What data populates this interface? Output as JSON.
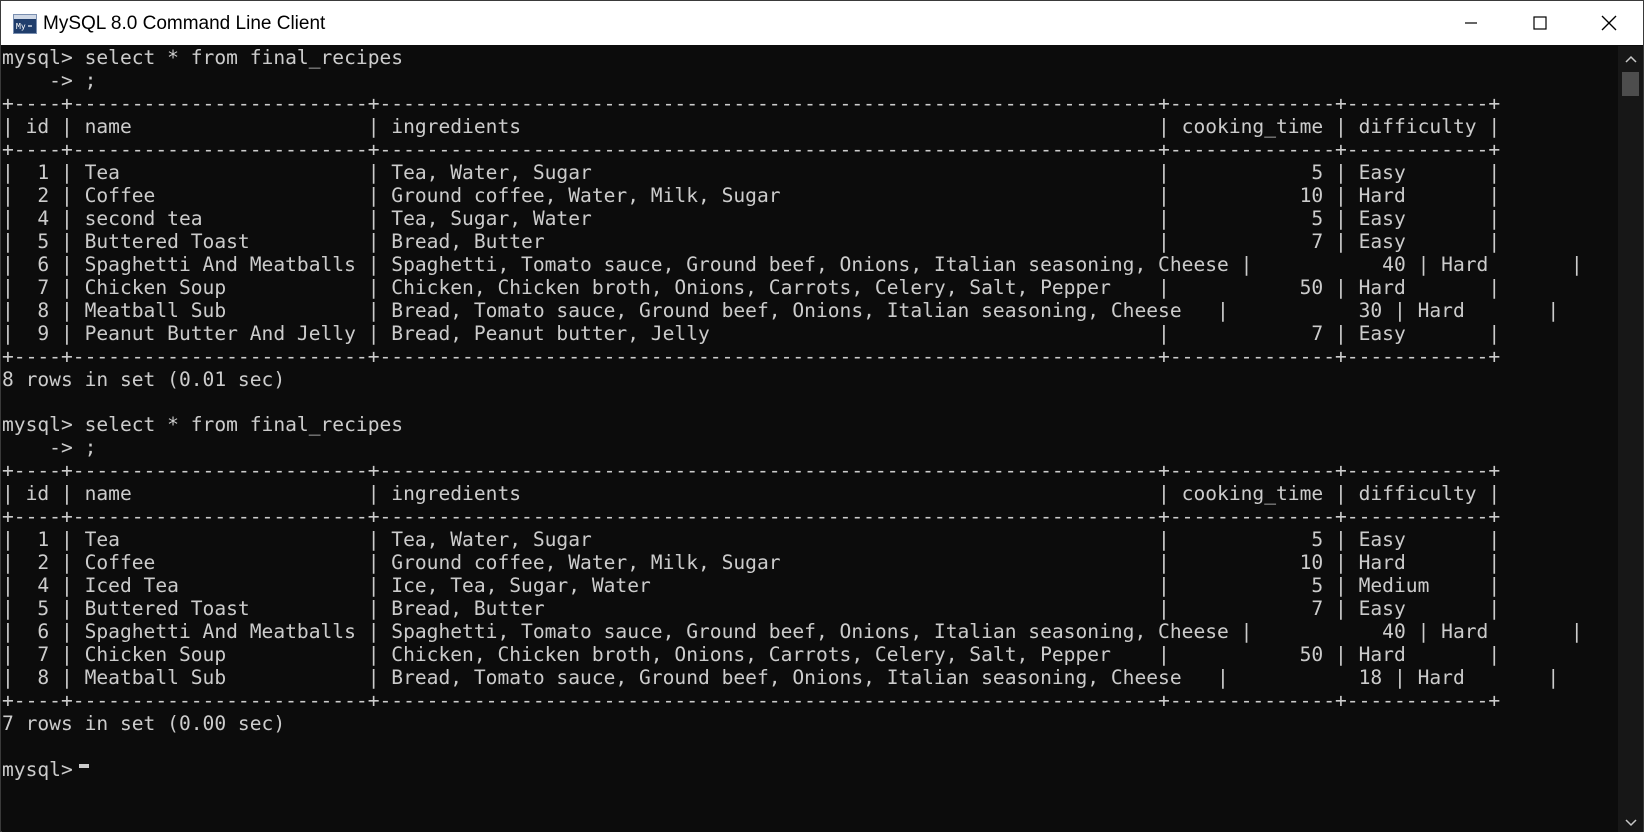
{
  "window": {
    "title": "MySQL 8.0 Command Line Client",
    "icons": {
      "app": "mysql-console-icon",
      "minimize": "minimize-icon",
      "maximize": "maximize-icon",
      "close": "close-icon"
    }
  },
  "colors": {
    "console_background": "#0c0c0c",
    "console_text": "#cccccc",
    "titlebar_background": "#ffffff"
  },
  "terminal": {
    "lines": [
      "mysql> select * from final_recipes",
      "    -> ;",
      "+----+-------------------------+------------------------------------------------------------------+--------------+------------+",
      "| id | name                    | ingredients                                                      | cooking_time | difficulty |",
      "+----+-------------------------+------------------------------------------------------------------+--------------+------------+",
      "|  1 | Tea                     | Tea, Water, Sugar                                                |            5 | Easy       |",
      "|  2 | Coffee                  | Ground coffee, Water, Milk, Sugar                                |           10 | Hard       |",
      "|  4 | second tea              | Tea, Sugar, Water                                                |            5 | Easy       |",
      "|  5 | Buttered Toast          | Bread, Butter                                                    |            7 | Easy       |",
      "|  6 | Spaghetti And Meatballs | Spaghetti, Tomato sauce, Ground beef, Onions, Italian seasoning, Cheese |           40 | Hard       |",
      "|  7 | Chicken Soup            | Chicken, Chicken broth, Onions, Carrots, Celery, Salt, Pepper    |           50 | Hard       |",
      "|  8 | Meatball Sub            | Bread, Tomato sauce, Ground beef, Onions, Italian seasoning, Cheese   |           30 | Hard       |",
      "|  9 | Peanut Butter And Jelly | Bread, Peanut butter, Jelly                                      |            7 | Easy       |",
      "+----+-------------------------+------------------------------------------------------------------+--------------+------------+",
      "8 rows in set (0.01 sec)",
      "",
      "mysql> select * from final_recipes",
      "    -> ;",
      "+----+-------------------------+------------------------------------------------------------------+--------------+------------+",
      "| id | name                    | ingredients                                                      | cooking_time | difficulty |",
      "+----+-------------------------+------------------------------------------------------------------+--------------+------------+",
      "|  1 | Tea                     | Tea, Water, Sugar                                                |            5 | Easy       |",
      "|  2 | Coffee                  | Ground coffee, Water, Milk, Sugar                                |           10 | Hard       |",
      "|  4 | Iced Tea                | Ice, Tea, Sugar, Water                                           |            5 | Medium     |",
      "|  5 | Buttered Toast          | Bread, Butter                                                    |            7 | Easy       |",
      "|  6 | Spaghetti And Meatballs | Spaghetti, Tomato sauce, Ground beef, Onions, Italian seasoning, Cheese |           40 | Hard       |",
      "|  7 | Chicken Soup            | Chicken, Chicken broth, Onions, Carrots, Celery, Salt, Pepper    |           50 | Hard       |",
      "|  8 | Meatball Sub            | Bread, Tomato sauce, Ground beef, Onions, Italian seasoning, Cheese   |           18 | Hard       |",
      "+----+-------------------------+------------------------------------------------------------------+--------------+------------+",
      "7 rows in set (0.00 sec)",
      "",
      "mysql> "
    ]
  }
}
